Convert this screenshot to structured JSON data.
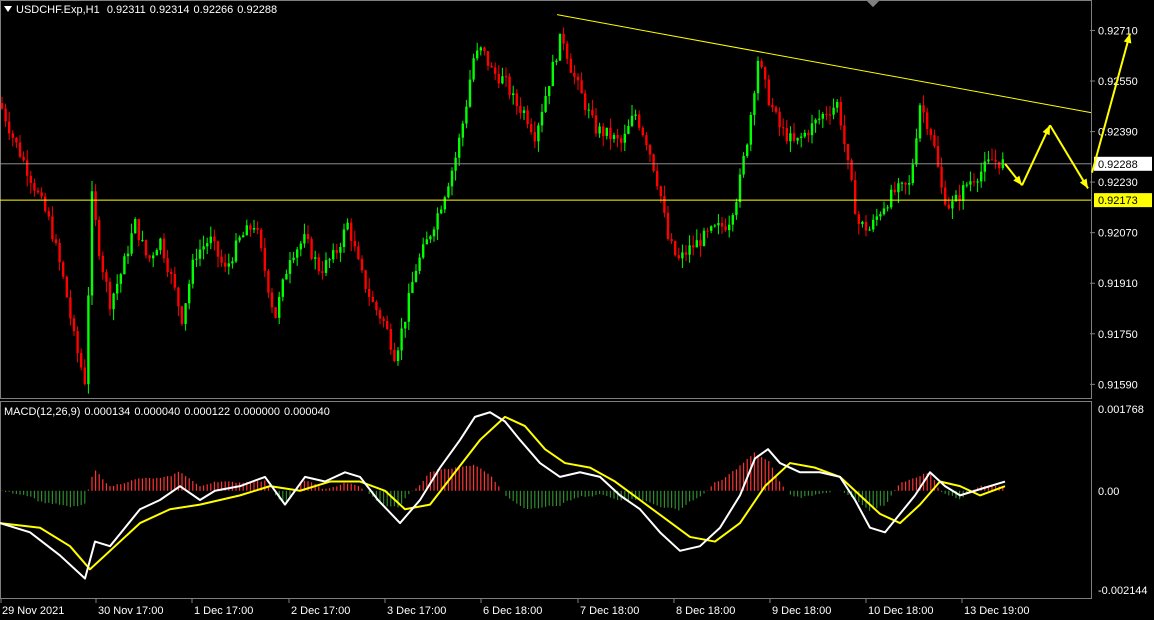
{
  "header": {
    "symbol": "USDCHF.Exp,H1",
    "open": "0.92311",
    "high": "0.92314",
    "low": "0.92266",
    "close": "0.92288"
  },
  "macd_header": {
    "name": "MACD(12,26,9)",
    "values": [
      "0.000134",
      "0.000040",
      "0.000122",
      "0.000000",
      "0.000040"
    ]
  },
  "colors": {
    "background": "#000000",
    "bull": "#00ff00",
    "bear": "#ff0000",
    "hist_pos": "#ff3333",
    "hist_neg": "#2e8b2e",
    "macd_line": "#ffffff",
    "signal_line": "#ffff00",
    "trend_line": "#ffff00",
    "bid_line": "#a0a0a0",
    "level_line": "#ffff00",
    "arrow": "#ffff00",
    "grid_border": "#7f7f7f"
  },
  "chart_data": [
    {
      "type": "candlestick",
      "symbol": "USDCHF.Exp",
      "timeframe": "H1",
      "price_axis": [
        "0.92710",
        "0.92550",
        "0.92390",
        "0.92230",
        "0.92070",
        "0.91910",
        "0.91750",
        "0.91590"
      ],
      "ylim": [
        0.9155,
        0.928
      ],
      "time_axis": [
        "29 Nov 2021",
        "30 Nov 17:00",
        "1 Dec 17:00",
        "2 Dec 17:00",
        "3 Dec 17:00",
        "6 Dec 18:00",
        "7 Dec 18:00",
        "8 Dec 18:00",
        "9 Dec 18:00",
        "10 Dec 18:00",
        "13 Dec 19:00"
      ],
      "current_price": "0.92288",
      "horizontal_level": "0.92173",
      "close_path": [
        [
          0,
          0.9248
        ],
        [
          12,
          0.9238
        ],
        [
          30,
          0.9225
        ],
        [
          50,
          0.921
        ],
        [
          65,
          0.919
        ],
        [
          75,
          0.9172
        ],
        [
          85,
          0.916
        ],
        [
          92,
          0.9218
        ],
        [
          100,
          0.92
        ],
        [
          110,
          0.9185
        ],
        [
          122,
          0.9195
        ],
        [
          135,
          0.921
        ],
        [
          148,
          0.9198
        ],
        [
          160,
          0.9205
        ],
        [
          172,
          0.9192
        ],
        [
          182,
          0.918
        ],
        [
          195,
          0.92
        ],
        [
          210,
          0.9205
        ],
        [
          225,
          0.9195
        ],
        [
          240,
          0.9205
        ],
        [
          255,
          0.921
        ],
        [
          265,
          0.9195
        ],
        [
          275,
          0.918
        ],
        [
          290,
          0.92
        ],
        [
          305,
          0.9205
        ],
        [
          320,
          0.9195
        ],
        [
          335,
          0.92
        ],
        [
          348,
          0.921
        ],
        [
          360,
          0.9195
        ],
        [
          372,
          0.9185
        ],
        [
          385,
          0.9178
        ],
        [
          395,
          0.9168
        ],
        [
          405,
          0.918
        ],
        [
          415,
          0.9195
        ],
        [
          428,
          0.9205
        ],
        [
          440,
          0.9215
        ],
        [
          455,
          0.923
        ],
        [
          465,
          0.9245
        ],
        [
          473,
          0.9262
        ],
        [
          482,
          0.9265
        ],
        [
          492,
          0.9258
        ],
        [
          505,
          0.9255
        ],
        [
          515,
          0.9248
        ],
        [
          525,
          0.9245
        ],
        [
          535,
          0.9238
        ],
        [
          545,
          0.925
        ],
        [
          555,
          0.9262
        ],
        [
          562,
          0.927
        ],
        [
          572,
          0.9258
        ],
        [
          582,
          0.925
        ],
        [
          595,
          0.924
        ],
        [
          608,
          0.9238
        ],
        [
          622,
          0.9235
        ],
        [
          635,
          0.9245
        ],
        [
          648,
          0.9235
        ],
        [
          660,
          0.922
        ],
        [
          668,
          0.9205
        ],
        [
          678,
          0.9198
        ],
        [
          690,
          0.9202
        ],
        [
          702,
          0.9205
        ],
        [
          715,
          0.9208
        ],
        [
          728,
          0.921
        ],
        [
          738,
          0.922
        ],
        [
          748,
          0.9238
        ],
        [
          758,
          0.9262
        ],
        [
          768,
          0.925
        ],
        [
          780,
          0.924
        ],
        [
          795,
          0.9235
        ],
        [
          810,
          0.924
        ],
        [
          825,
          0.9245
        ],
        [
          838,
          0.9248
        ],
        [
          848,
          0.9228
        ],
        [
          858,
          0.921
        ],
        [
          870,
          0.9208
        ],
        [
          882,
          0.9215
        ],
        [
          895,
          0.922
        ],
        [
          910,
          0.9222
        ],
        [
          920,
          0.9248
        ],
        [
          932,
          0.9238
        ],
        [
          942,
          0.922
        ],
        [
          950,
          0.9215
        ],
        [
          958,
          0.9218
        ],
        [
          968,
          0.9223
        ],
        [
          980,
          0.9226
        ],
        [
          992,
          0.923
        ],
        [
          1005,
          0.92288
        ]
      ],
      "trend_line": {
        "from": [
          "6 Dec 18:00",
          0.9276
        ],
        "to": [
          "13 Dec 19:00",
          0.9245
        ]
      },
      "projected_path": [
        [
          1005,
          0.92288
        ],
        [
          1022,
          0.9222
        ],
        [
          1050,
          0.9241
        ],
        [
          1088,
          0.9221
        ]
      ],
      "projected_up": [
        [
          1092,
          0.9226
        ],
        [
          1130,
          0.927
        ]
      ]
    },
    {
      "type": "macd",
      "params": "12,26,9",
      "axis_labels": [
        "0.001768",
        "0.00",
        "-0.002144"
      ],
      "ylim": [
        -0.0023,
        0.0019
      ],
      "macd_line": [
        [
          0,
          -0.0007
        ],
        [
          30,
          -0.0009
        ],
        [
          60,
          -0.0014
        ],
        [
          85,
          -0.0019
        ],
        [
          95,
          -0.0011
        ],
        [
          110,
          -0.0012
        ],
        [
          125,
          -0.0008
        ],
        [
          140,
          -0.0004
        ],
        [
          160,
          -0.0002
        ],
        [
          180,
          0.0001
        ],
        [
          200,
          -0.0002
        ],
        [
          215,
          0.0
        ],
        [
          240,
          0.0001
        ],
        [
          265,
          0.0003
        ],
        [
          285,
          -0.0003
        ],
        [
          305,
          0.0003
        ],
        [
          325,
          0.0002
        ],
        [
          345,
          0.0004
        ],
        [
          360,
          0.0003
        ],
        [
          378,
          -0.0002
        ],
        [
          400,
          -0.0007
        ],
        [
          420,
          -0.0002
        ],
        [
          440,
          0.0005
        ],
        [
          460,
          0.0011
        ],
        [
          475,
          0.0016
        ],
        [
          490,
          0.0017
        ],
        [
          505,
          0.0015
        ],
        [
          520,
          0.0011
        ],
        [
          540,
          0.0006
        ],
        [
          560,
          0.0003
        ],
        [
          580,
          0.0004
        ],
        [
          600,
          0.0003
        ],
        [
          620,
          -0.0001
        ],
        [
          640,
          -0.0004
        ],
        [
          660,
          -0.0009
        ],
        [
          680,
          -0.0013
        ],
        [
          700,
          -0.0012
        ],
        [
          720,
          -0.0008
        ],
        [
          740,
          -0.0001
        ],
        [
          755,
          0.0007
        ],
        [
          768,
          0.0009
        ],
        [
          780,
          0.0006
        ],
        [
          800,
          0.0004
        ],
        [
          820,
          0.0004
        ],
        [
          840,
          0.0003
        ],
        [
          855,
          -0.0002
        ],
        [
          870,
          -0.0008
        ],
        [
          885,
          -0.0009
        ],
        [
          900,
          -0.0005
        ],
        [
          915,
          -0.0001
        ],
        [
          930,
          0.0004
        ],
        [
          945,
          0.0001
        ],
        [
          960,
          -0.0001
        ],
        [
          975,
          0.0
        ],
        [
          990,
          0.0001
        ],
        [
          1005,
          0.0002
        ]
      ],
      "signal_line": [
        [
          0,
          -0.0007
        ],
        [
          40,
          -0.0008
        ],
        [
          70,
          -0.0012
        ],
        [
          90,
          -0.0017
        ],
        [
          110,
          -0.0013
        ],
        [
          140,
          -0.0007
        ],
        [
          170,
          -0.0004
        ],
        [
          200,
          -0.0003
        ],
        [
          240,
          -0.0001
        ],
        [
          270,
          0.0001
        ],
        [
          300,
          0.0
        ],
        [
          330,
          0.0002
        ],
        [
          360,
          0.0002
        ],
        [
          385,
          0.0
        ],
        [
          405,
          -0.0004
        ],
        [
          430,
          -0.0003
        ],
        [
          455,
          0.0004
        ],
        [
          480,
          0.0011
        ],
        [
          505,
          0.0016
        ],
        [
          525,
          0.0014
        ],
        [
          545,
          0.0009
        ],
        [
          565,
          0.0006
        ],
        [
          590,
          0.0005
        ],
        [
          615,
          0.0002
        ],
        [
          640,
          -0.0002
        ],
        [
          665,
          -0.0006
        ],
        [
          690,
          -0.001
        ],
        [
          715,
          -0.0011
        ],
        [
          740,
          -0.0007
        ],
        [
          765,
          0.0001
        ],
        [
          790,
          0.0006
        ],
        [
          815,
          0.0005
        ],
        [
          840,
          0.0003
        ],
        [
          860,
          -0.0001
        ],
        [
          880,
          -0.0005
        ],
        [
          900,
          -0.0007
        ],
        [
          920,
          -0.0003
        ],
        [
          940,
          0.0002
        ],
        [
          960,
          0.0001
        ],
        [
          980,
          -0.0001
        ],
        [
          1005,
          0.0001
        ]
      ]
    }
  ]
}
